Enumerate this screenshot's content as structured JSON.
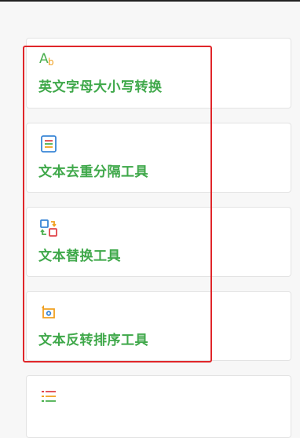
{
  "tools": [
    {
      "label": "英文字母大小写转换",
      "icon": "text-case-icon"
    },
    {
      "label": "文本去重分隔工具",
      "icon": "document-lines-icon"
    },
    {
      "label": "文本替换工具",
      "icon": "replace-icon"
    },
    {
      "label": "文本反转排序工具",
      "icon": "reverse-icon"
    },
    {
      "label": "",
      "icon": "list-icon"
    }
  ],
  "colors": {
    "label_green": "#3fa84a",
    "highlight_red": "#e0262a",
    "icon_orange": "#f0a020",
    "icon_blue": "#3a86d6",
    "icon_red": "#e0444a",
    "icon_green": "#4cb050"
  }
}
